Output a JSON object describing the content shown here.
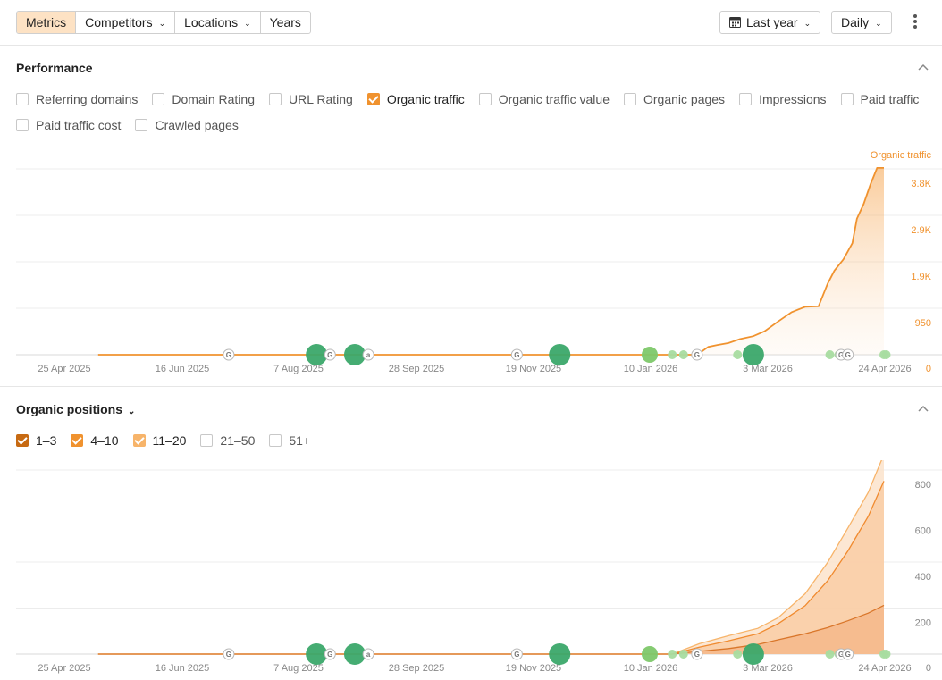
{
  "toolbar": {
    "tabs": [
      {
        "label": "Metrics",
        "active": true,
        "dropdown": false
      },
      {
        "label": "Competitors",
        "active": false,
        "dropdown": true
      },
      {
        "label": "Locations",
        "active": false,
        "dropdown": true
      },
      {
        "label": "Years",
        "active": false,
        "dropdown": false
      }
    ],
    "period_label": "Last year",
    "granularity_label": "Daily",
    "icons": {
      "calendar": "calendar-icon",
      "more": "more-vertical-icon",
      "chevron": "chevron-down-icon"
    }
  },
  "performance": {
    "title": "Performance",
    "metrics": [
      {
        "label": "Referring domains",
        "checked": false
      },
      {
        "label": "Domain Rating",
        "checked": false
      },
      {
        "label": "URL Rating",
        "checked": false
      },
      {
        "label": "Organic traffic",
        "checked": true
      },
      {
        "label": "Organic traffic value",
        "checked": false
      },
      {
        "label": "Organic pages",
        "checked": false
      },
      {
        "label": "Impressions",
        "checked": false
      },
      {
        "label": "Paid traffic",
        "checked": false
      },
      {
        "label": "Paid traffic cost",
        "checked": false
      },
      {
        "label": "Crawled pages",
        "checked": false
      }
    ]
  },
  "positions": {
    "title": "Organic positions",
    "ranges": [
      {
        "label": "1–3",
        "checked": true,
        "color": "#c76a12"
      },
      {
        "label": "4–10",
        "checked": true,
        "color": "#f0922e"
      },
      {
        "label": "11–20",
        "checked": true,
        "color": "#f7b46a"
      },
      {
        "label": "21–50",
        "checked": false,
        "color": "#c8c8c8"
      },
      {
        "label": "51+",
        "checked": false,
        "color": "#c8c8c8"
      }
    ]
  },
  "chart_data": [
    {
      "type": "area",
      "series": [
        {
          "name": "Organic traffic",
          "color": "#f0922e"
        }
      ],
      "x_ticks": [
        "25 Apr 2025",
        "16 Jun 2025",
        "7 Aug 2025",
        "28 Sep 2025",
        "19 Nov 2025",
        "10 Jan 2026",
        "3 Mar 2026",
        "24 Apr 2026"
      ],
      "y_ticks": [
        "0",
        "950",
        "1.9K",
        "2.9K",
        "3.8K"
      ],
      "y_tick_values": [
        0,
        950,
        1900,
        2900,
        3800
      ],
      "ylim": [
        0,
        3800
      ],
      "x": [
        "2025-05-10",
        "2026-01-20",
        "2026-01-29",
        "2026-02-01",
        "2026-02-05",
        "2026-02-09",
        "2026-02-14",
        "2026-02-19",
        "2026-02-25",
        "2026-03-02",
        "2026-03-08",
        "2026-03-14",
        "2026-03-20",
        "2026-03-26",
        "2026-03-30",
        "2026-04-02",
        "2026-04-06",
        "2026-04-10",
        "2026-04-12",
        "2026-04-15",
        "2026-04-18",
        "2026-04-21",
        "2026-04-24"
      ],
      "values": [
        0,
        0,
        0,
        30,
        160,
        200,
        240,
        320,
        380,
        480,
        680,
        870,
        980,
        990,
        1450,
        1720,
        1950,
        2280,
        2780,
        3080,
        3480,
        3820,
        3820
      ],
      "grid": true
    },
    {
      "type": "area",
      "series": [
        {
          "name": "1–3",
          "color": "#c76a12",
          "values": [
            0,
            0,
            12,
            24,
            42,
            62,
            88,
            115,
            145,
            178,
            212
          ]
        },
        {
          "name": "4–10",
          "color": "#f0922e",
          "values": [
            0,
            0,
            30,
            58,
            88,
            132,
            210,
            318,
            448,
            598,
            752
          ]
        },
        {
          "name": "11–20",
          "color": "#f7b46a",
          "values": [
            0,
            0,
            45,
            80,
            112,
            158,
            262,
            398,
            548,
            702,
            868
          ]
        }
      ],
      "x": [
        "2025-05-10",
        "2026-01-20",
        "2026-02-01",
        "2026-02-14",
        "2026-02-27",
        "2026-03-08",
        "2026-03-20",
        "2026-03-30",
        "2026-04-08",
        "2026-04-17",
        "2026-04-24"
      ],
      "x_ticks": [
        "25 Apr 2025",
        "16 Jun 2025",
        "7 Aug 2025",
        "28 Sep 2025",
        "19 Nov 2025",
        "10 Jan 2026",
        "3 Mar 2026",
        "24 Apr 2026"
      ],
      "y_ticks": [
        "0",
        "200",
        "400",
        "600",
        "800"
      ],
      "y_tick_values": [
        0,
        200,
        400,
        600,
        800
      ],
      "ylim": [
        0,
        800
      ],
      "grid": true
    }
  ],
  "events": [
    {
      "date": "2025-07-07",
      "kind": "google"
    },
    {
      "date": "2025-08-15",
      "kind": "bubble",
      "size": "large"
    },
    {
      "date": "2025-08-21",
      "kind": "google"
    },
    {
      "date": "2025-09-01",
      "kind": "bubble",
      "size": "large"
    },
    {
      "date": "2025-09-07",
      "kind": "ahrefs"
    },
    {
      "date": "2025-11-12",
      "kind": "google"
    },
    {
      "date": "2025-12-01",
      "kind": "bubble",
      "size": "large"
    },
    {
      "date": "2026-01-10",
      "kind": "bubble",
      "size": "medium"
    },
    {
      "date": "2026-01-20",
      "kind": "bubble",
      "size": "small"
    },
    {
      "date": "2026-01-25",
      "kind": "bubble",
      "size": "small"
    },
    {
      "date": "2026-01-31",
      "kind": "google"
    },
    {
      "date": "2026-02-18",
      "kind": "bubble",
      "size": "small"
    },
    {
      "date": "2026-02-25",
      "kind": "bubble",
      "size": "large"
    },
    {
      "date": "2026-03-31",
      "kind": "bubble",
      "size": "small"
    },
    {
      "date": "2026-04-04",
      "kind": "bubble",
      "size": "small"
    },
    {
      "date": "2026-04-05",
      "kind": "google"
    },
    {
      "date": "2026-04-08",
      "kind": "google"
    },
    {
      "date": "2026-04-24",
      "kind": "bubble",
      "size": "small"
    },
    {
      "date": "2026-04-25",
      "kind": "bubble",
      "size": "small"
    }
  ]
}
